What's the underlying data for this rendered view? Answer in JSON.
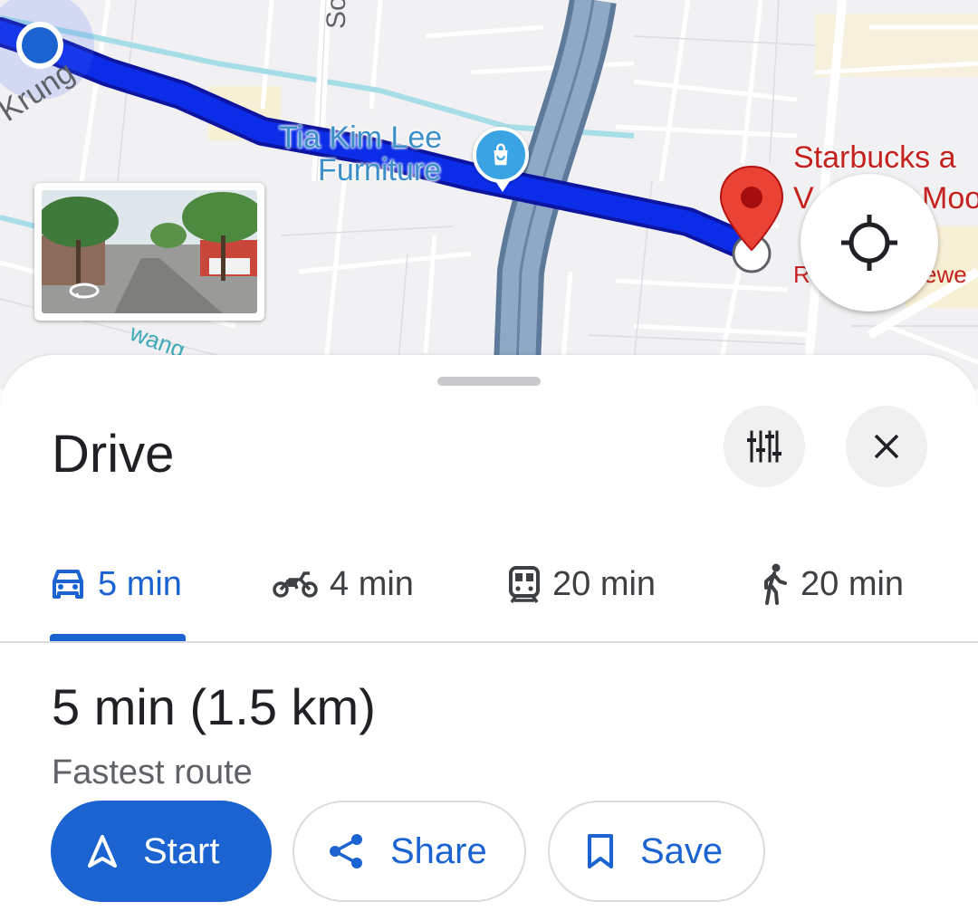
{
  "map": {
    "street_labels": {
      "krung": "Krung",
      "so": "So",
      "wang": "wang"
    },
    "poi": {
      "furniture_line1": "Tia Kim Lee",
      "furniture_line2": "Furniture",
      "starbucks_line1": "Starbucks a",
      "starbucks_line2": "V",
      "starbucks_line2b": "Moor",
      "r_letter": "R",
      "ewe": "ewe"
    },
    "route_color": "#0a24d6",
    "origin_color": "#1a63d0",
    "destination_pin_color": "#ea4335",
    "icons": {
      "shop": "shopping-bag-icon",
      "streetview": "rotate-360-icon",
      "locate": "my-location-icon"
    }
  },
  "sheet": {
    "title": "Drive",
    "options_icon": "tune-icon",
    "close_icon": "close-icon",
    "tabs": [
      {
        "icon": "car-icon",
        "label": "5 min",
        "active": true
      },
      {
        "icon": "motorcycle-icon",
        "label": "4 min",
        "active": false
      },
      {
        "icon": "transit-icon",
        "label": "20 min",
        "active": false
      },
      {
        "icon": "walk-icon",
        "label": "20 min",
        "active": false
      }
    ],
    "summary": "5 min (1.5 km)",
    "subtitle": "Fastest route",
    "actions": {
      "start": "Start",
      "share": "Share",
      "save": "Save"
    },
    "accent_color": "#1a63d0"
  }
}
